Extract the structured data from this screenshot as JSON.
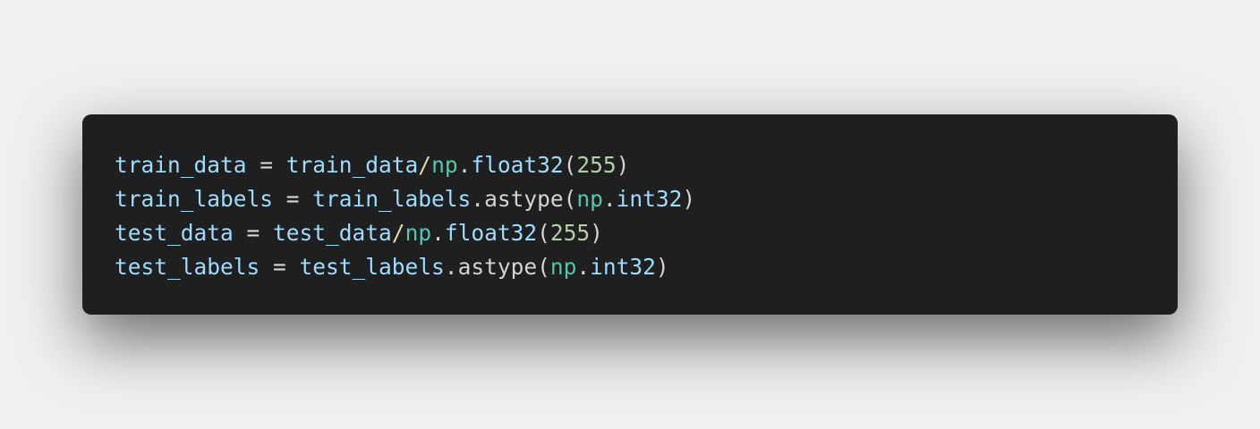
{
  "code": {
    "lines": [
      {
        "tokens": [
          {
            "text": "train_data",
            "kind": "var"
          },
          {
            "text": " = ",
            "kind": "op"
          },
          {
            "text": "train_data",
            "kind": "var"
          },
          {
            "text": "/",
            "kind": "fn"
          },
          {
            "text": "np",
            "kind": "mod"
          },
          {
            "text": ".",
            "kind": "punc"
          },
          {
            "text": "float32",
            "kind": "var"
          },
          {
            "text": "(",
            "kind": "punc"
          },
          {
            "text": "255",
            "kind": "num"
          },
          {
            "text": ")",
            "kind": "punc"
          }
        ]
      },
      {
        "tokens": [
          {
            "text": "train_labels",
            "kind": "var"
          },
          {
            "text": " = ",
            "kind": "op"
          },
          {
            "text": "train_labels",
            "kind": "var"
          },
          {
            "text": ".",
            "kind": "punc"
          },
          {
            "text": "astype",
            "kind": "plain"
          },
          {
            "text": "(",
            "kind": "punc"
          },
          {
            "text": "np",
            "kind": "mod"
          },
          {
            "text": ".",
            "kind": "punc"
          },
          {
            "text": "int32",
            "kind": "var"
          },
          {
            "text": ")",
            "kind": "punc"
          }
        ]
      },
      {
        "tokens": [
          {
            "text": "test_data",
            "kind": "var"
          },
          {
            "text": " = ",
            "kind": "op"
          },
          {
            "text": "test_data",
            "kind": "var"
          },
          {
            "text": "/",
            "kind": "fn"
          },
          {
            "text": "np",
            "kind": "mod"
          },
          {
            "text": ".",
            "kind": "punc"
          },
          {
            "text": "float32",
            "kind": "var"
          },
          {
            "text": "(",
            "kind": "punc"
          },
          {
            "text": "255",
            "kind": "num"
          },
          {
            "text": ")",
            "kind": "punc"
          }
        ]
      },
      {
        "tokens": [
          {
            "text": "test_labels",
            "kind": "var"
          },
          {
            "text": " = ",
            "kind": "op"
          },
          {
            "text": "test_labels",
            "kind": "var"
          },
          {
            "text": ".",
            "kind": "punc"
          },
          {
            "text": "astype",
            "kind": "plain"
          },
          {
            "text": "(",
            "kind": "punc"
          },
          {
            "text": "np",
            "kind": "mod"
          },
          {
            "text": ".",
            "kind": "punc"
          },
          {
            "text": "int32",
            "kind": "var"
          },
          {
            "text": ")",
            "kind": "punc"
          }
        ]
      }
    ]
  },
  "colors": {
    "page_background": "#f0f0f0",
    "code_background": "#1f1f1f",
    "variable": "#9cdcfe",
    "module": "#4ec9b0",
    "number": "#b5cea8",
    "operator": "#d4d4d4"
  }
}
